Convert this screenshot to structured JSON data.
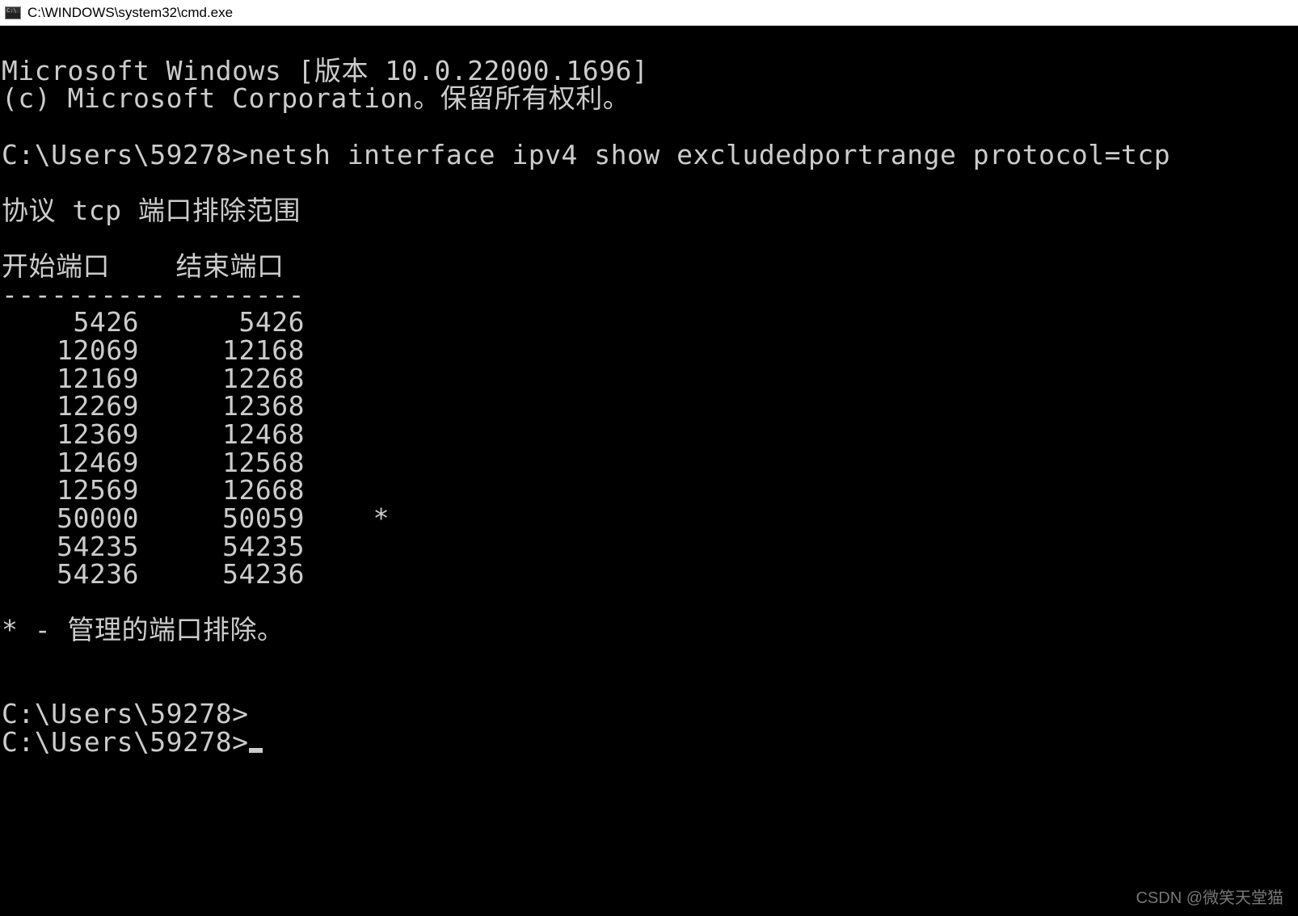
{
  "window": {
    "title": "C:\\WINDOWS\\system32\\cmd.exe"
  },
  "terminal": {
    "banner_line1": "Microsoft Windows [版本 10.0.22000.1696]",
    "banner_line2": "(c) Microsoft Corporation。保留所有权利。",
    "prompt1": "C:\\Users\\59278>",
    "command1": "netsh interface ipv4 show excludedportrange protocol=tcp",
    "section_title": "协议 tcp 端口排除范围",
    "header_start": "开始端口",
    "header_end": "结束端口",
    "divider_start": "----------",
    "divider_end": "--------",
    "rows": [
      {
        "start": "5426",
        "end": "5426",
        "mark": ""
      },
      {
        "start": "12069",
        "end": "12168",
        "mark": ""
      },
      {
        "start": "12169",
        "end": "12268",
        "mark": ""
      },
      {
        "start": "12269",
        "end": "12368",
        "mark": ""
      },
      {
        "start": "12369",
        "end": "12468",
        "mark": ""
      },
      {
        "start": "12469",
        "end": "12568",
        "mark": ""
      },
      {
        "start": "12569",
        "end": "12668",
        "mark": ""
      },
      {
        "start": "50000",
        "end": "50059",
        "mark": "*"
      },
      {
        "start": "54235",
        "end": "54235",
        "mark": ""
      },
      {
        "start": "54236",
        "end": "54236",
        "mark": ""
      }
    ],
    "footnote": "* - 管理的端口排除。",
    "prompt2": "C:\\Users\\59278>",
    "prompt3": "C:\\Users\\59278>"
  },
  "watermark": "CSDN @微笑天堂猫"
}
